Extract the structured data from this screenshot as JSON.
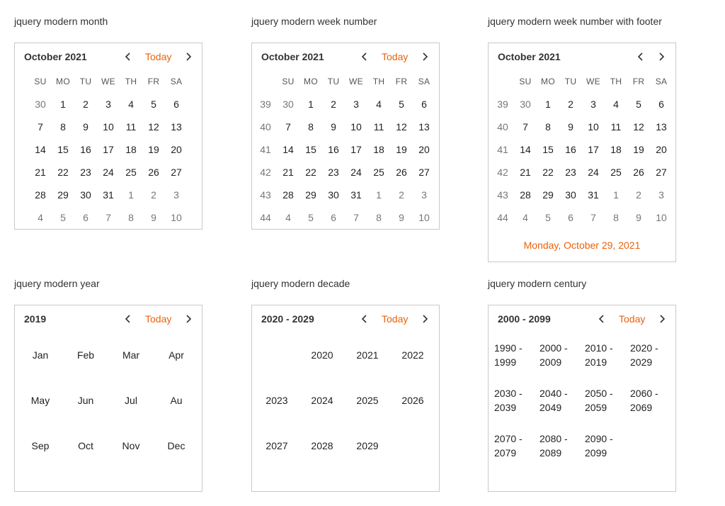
{
  "accent_color": "#e8620d",
  "icons": {
    "prev": "chevron-left-icon",
    "next": "chevron-right-icon"
  },
  "month": {
    "title": "jquery modern month",
    "header": "October 2021",
    "today": "Today",
    "dow": [
      "SU",
      "MO",
      "TU",
      "WE",
      "TH",
      "FR",
      "SA"
    ],
    "weeks": [
      [
        "30",
        "1",
        "2",
        "3",
        "4",
        "5",
        "6"
      ],
      [
        "7",
        "8",
        "9",
        "10",
        "11",
        "12",
        "13"
      ],
      [
        "14",
        "15",
        "16",
        "17",
        "18",
        "19",
        "20"
      ],
      [
        "21",
        "22",
        "23",
        "24",
        "25",
        "26",
        "27"
      ],
      [
        "28",
        "29",
        "30",
        "31",
        "1",
        "2",
        "3"
      ],
      [
        "4",
        "5",
        "6",
        "7",
        "8",
        "9",
        "10"
      ]
    ]
  },
  "weeknum": {
    "title": "jquery modern week number",
    "header": "October 2021",
    "today": "Today",
    "week_numbers": [
      "39",
      "40",
      "41",
      "42",
      "43",
      "44"
    ]
  },
  "weeknum_footer": {
    "title": "jquery modern week number with footer",
    "header": "October 2021",
    "footer": "Monday, October 29, 2021"
  },
  "year": {
    "title": "jquery modern year",
    "header": "2019",
    "today": "Today",
    "months": [
      "Jan",
      "Feb",
      "Mar",
      "Apr",
      "May",
      "Jun",
      "Jul",
      "Au",
      "Sep",
      "Oct",
      "Nov",
      "Dec"
    ]
  },
  "decade": {
    "title": "jquery modern decade",
    "header": "2020 - 2029",
    "today": "Today",
    "years": [
      "2020",
      "2021",
      "2022",
      "2023",
      "2024",
      "2025",
      "2026",
      "2027",
      "2028",
      "2029"
    ]
  },
  "century": {
    "title": "jquery modern century",
    "header": "2000 - 2099",
    "today": "Today",
    "decades": [
      [
        "1990 -",
        "1999"
      ],
      [
        "2000 -",
        "2009"
      ],
      [
        "2010 -",
        "2019"
      ],
      [
        "2020 -",
        "2029"
      ],
      [
        "2030 -",
        "2039"
      ],
      [
        "2040 -",
        "2049"
      ],
      [
        "2050 -",
        "2059"
      ],
      [
        "2060 -",
        "2069"
      ],
      [
        "2070 -",
        "2079"
      ],
      [
        "2080 -",
        "2089"
      ],
      [
        "2090 -",
        "2099"
      ]
    ]
  }
}
